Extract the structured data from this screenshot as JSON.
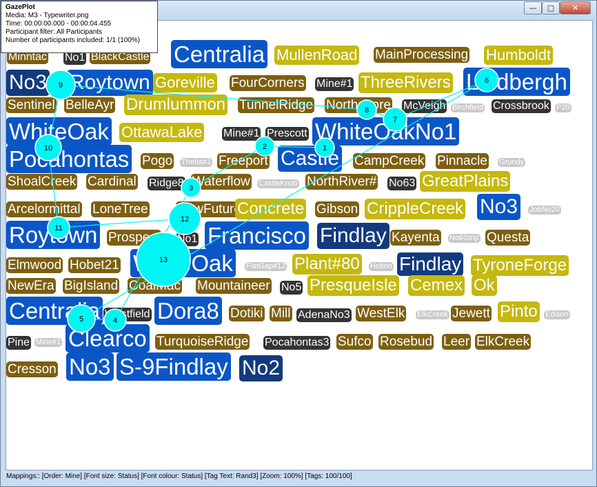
{
  "window": {
    "minimize_glyph": "—",
    "maximize_glyph": "□",
    "close_glyph": "✕"
  },
  "info": {
    "title": "GazePlot",
    "media": "Media: M3 - Typewriter.png",
    "time": "Time: 00:00:00.000 - 00:00:04.455",
    "filter": "Participant filter: All Participants",
    "participants": "Number of participants included: 1/1 (100%)"
  },
  "palette": {
    "blue": "#0b56c6",
    "navy": "#133a7e",
    "brown": "#7d5f10",
    "olive": "#c5b80e",
    "dark": "#343434",
    "light": "#c9c9c9",
    "gaze": "#00f5f5"
  },
  "tags": [
    {
      "text": "Minntac",
      "color": "brown"
    },
    {
      "text": "No1",
      "color": "dark"
    },
    {
      "text": "BlackCastle",
      "color": "brown"
    },
    {
      "text": "Centralia",
      "color": "blue"
    },
    {
      "text": "MullenRoad",
      "color": "olive"
    },
    {
      "text": "MainProcessing",
      "color": "brown"
    },
    {
      "text": "Humboldt",
      "color": "olive"
    },
    {
      "text": "No3",
      "color": "navy"
    },
    {
      "text": "Roytown",
      "color": "blue"
    },
    {
      "text": "Goreville",
      "color": "olive"
    },
    {
      "text": "FourCorners",
      "color": "brown"
    },
    {
      "text": "Mine#1",
      "color": "dark"
    },
    {
      "text": "ThreeRivers",
      "color": "olive"
    },
    {
      "text": "Lindbergh",
      "color": "blue"
    },
    {
      "text": "Sentinel",
      "color": "brown"
    },
    {
      "text": "BelleAyr",
      "color": "brown"
    },
    {
      "text": "Drumlummon",
      "color": "olive"
    },
    {
      "text": "TunnelRidge",
      "color": "brown"
    },
    {
      "text": "Northshore",
      "color": "brown"
    },
    {
      "text": "McVeigh",
      "color": "dark"
    },
    {
      "text": "Birchfield",
      "color": "light"
    },
    {
      "text": "Crossbrook",
      "color": "dark"
    },
    {
      "text": "P20",
      "color": "light"
    },
    {
      "text": "WhiteOak",
      "color": "blue"
    },
    {
      "text": "OttawaLake",
      "color": "olive"
    },
    {
      "text": "Mine#1",
      "color": "dark"
    },
    {
      "text": "Prescott",
      "color": "dark"
    },
    {
      "text": "WhiteOakNo1",
      "color": "blue"
    },
    {
      "text": "Pocahontas",
      "color": "blue"
    },
    {
      "text": "Pogo",
      "color": "brown"
    },
    {
      "text": "Theba#1",
      "color": "light"
    },
    {
      "text": "Freeport",
      "color": "brown"
    },
    {
      "text": "Castle",
      "color": "blue"
    },
    {
      "text": "CampCreek",
      "color": "brown"
    },
    {
      "text": "Pinnacle",
      "color": "brown"
    },
    {
      "text": "Grundy",
      "color": "light"
    },
    {
      "text": "ShoalCreek",
      "color": "brown"
    },
    {
      "text": "Cardinal",
      "color": "brown"
    },
    {
      "text": "Ridge8",
      "color": "dark"
    },
    {
      "text": "Waterflow",
      "color": "brown"
    },
    {
      "text": "CastleKnob",
      "color": "light"
    },
    {
      "text": "NorthRiver#",
      "color": "brown"
    },
    {
      "text": "No63",
      "color": "dark"
    },
    {
      "text": "GreatPlains",
      "color": "olive"
    },
    {
      "text": "Arcelormittal",
      "color": "brown"
    },
    {
      "text": "LoneTree",
      "color": "brown"
    },
    {
      "text": "NewFuture",
      "color": "brown"
    },
    {
      "text": "Concrete",
      "color": "olive"
    },
    {
      "text": "Gibson",
      "color": "brown"
    },
    {
      "text": "CrippleCreek",
      "color": "olive"
    },
    {
      "text": "No3",
      "color": "blue"
    },
    {
      "text": "JobNo20",
      "color": "light"
    },
    {
      "text": "Roytown",
      "color": "blue"
    },
    {
      "text": "Prospect",
      "color": "brown"
    },
    {
      "text": "No1",
      "color": "dark"
    },
    {
      "text": "Francisco",
      "color": "blue"
    },
    {
      "text": "Findlay",
      "color": "navy"
    },
    {
      "text": "Kayenta",
      "color": "brown"
    },
    {
      "text": "No6Strip",
      "color": "light"
    },
    {
      "text": "Questa",
      "color": "brown"
    },
    {
      "text": "Elmwood",
      "color": "brown"
    },
    {
      "text": "Hobet21",
      "color": "brown"
    },
    {
      "text": "WhiteOak",
      "color": "blue"
    },
    {
      "text": "FlatGap#12",
      "color": "light"
    },
    {
      "text": "Plant#80",
      "color": "olive"
    },
    {
      "text": "Holton",
      "color": "light"
    },
    {
      "text": "Findlay",
      "color": "navy"
    },
    {
      "text": "TyroneForge",
      "color": "olive"
    },
    {
      "text": "NewEra",
      "color": "brown"
    },
    {
      "text": "BigIsland",
      "color": "brown"
    },
    {
      "text": "CoalMac",
      "color": "brown"
    },
    {
      "text": "Mountaineer",
      "color": "brown"
    },
    {
      "text": "No5",
      "color": "dark"
    },
    {
      "text": "PresqueIsle",
      "color": "olive"
    },
    {
      "text": "Cemex",
      "color": "olive"
    },
    {
      "text": "Ok",
      "color": "olive"
    },
    {
      "text": "Centralia",
      "color": "blue"
    },
    {
      "text": "Westfield",
      "color": "dark"
    },
    {
      "text": "Dora8",
      "color": "blue"
    },
    {
      "text": "Dotiki",
      "color": "brown"
    },
    {
      "text": "Mill",
      "color": "brown"
    },
    {
      "text": "AdenaNo3",
      "color": "dark"
    },
    {
      "text": "WestElk",
      "color": "brown"
    },
    {
      "text": "ElkCreek",
      "color": "light"
    },
    {
      "text": "Jewett",
      "color": "brown"
    },
    {
      "text": "Pinto",
      "color": "olive"
    },
    {
      "text": "Edison",
      "color": "light"
    },
    {
      "text": "Pine",
      "color": "dark"
    },
    {
      "text": "Mine#1",
      "color": "light"
    },
    {
      "text": "Clearco",
      "color": "blue"
    },
    {
      "text": "TurquoiseRidge",
      "color": "brown"
    },
    {
      "text": "Pocahontas3",
      "color": "dark"
    },
    {
      "text": "Sufco",
      "color": "brown"
    },
    {
      "text": "Rosebud",
      "color": "brown"
    },
    {
      "text": "Leer",
      "color": "brown"
    },
    {
      "text": "ElkCreek",
      "color": "brown"
    },
    {
      "text": "Cresson",
      "color": "brown"
    },
    {
      "text": "No3",
      "color": "blue"
    },
    {
      "text": "S-9Findlay",
      "color": "blue"
    },
    {
      "text": "No2",
      "color": "navy"
    }
  ],
  "fixations": [
    {
      "label": "1"
    },
    {
      "label": "2"
    },
    {
      "label": "3"
    },
    {
      "label": "4"
    },
    {
      "label": "5"
    },
    {
      "label": "6"
    },
    {
      "label": "7"
    },
    {
      "label": "8"
    },
    {
      "label": "9"
    },
    {
      "label": "10"
    },
    {
      "label": "11"
    },
    {
      "label": "12"
    },
    {
      "label": "13"
    }
  ],
  "status": {
    "text": "Mappings:: [Order: Mine] [Font size: Status] [Font colour: Status] [Tag Text: Rand3] [Zoom: 100%] [Tags: 100/100]"
  }
}
